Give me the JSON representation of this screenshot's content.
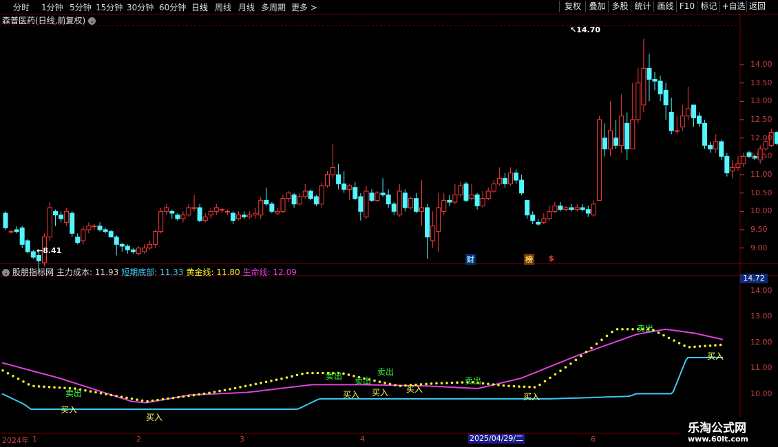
{
  "period_bar": {
    "items": [
      {
        "label": "分时",
        "x": 20
      },
      {
        "label": "1分钟",
        "x": 61
      },
      {
        "label": "5分钟",
        "x": 102
      },
      {
        "label": "15分钟",
        "x": 140
      },
      {
        "label": "30分钟",
        "x": 185
      },
      {
        "label": "60分钟",
        "x": 232
      },
      {
        "label": "日线",
        "x": 279,
        "active": true
      },
      {
        "label": "周线",
        "x": 313
      },
      {
        "label": "月线",
        "x": 347
      },
      {
        "label": "多周期",
        "x": 380
      },
      {
        "label": "更多",
        "x": 424
      }
    ],
    "more_arrow": ">",
    "right_buttons": [
      "复权",
      "叠加",
      "多股",
      "统计",
      "画线",
      "F10",
      "标记",
      "+自选",
      "返回"
    ]
  },
  "stock": {
    "title": "森普医药(日线,前复权)",
    "dropdown_icon": "⌄"
  },
  "price_axis": {
    "ticks": [
      "14.00",
      "13.50",
      "13.00",
      "12.50",
      "12.00",
      "11.50",
      "11.00",
      "10.50",
      "10.00",
      "9.50",
      "9.00"
    ]
  },
  "annotations": {
    "high": "14.70",
    "low": "8.41",
    "events": [
      "财",
      "榜",
      "$"
    ]
  },
  "indicator": {
    "name": "股朋指标网",
    "values": [
      {
        "label": "主力成本:",
        "value": "11.93",
        "color": "#dddddd"
      },
      {
        "label": "短期底部:",
        "value": "11.33",
        "color": "#3cc8f0"
      },
      {
        "label": "黄金线:",
        "value": "11.80",
        "color": "#f0f028"
      },
      {
        "label": "生命线:",
        "value": "12.09",
        "color": "#e040e0"
      }
    ],
    "axis_ticks": [
      "14.00",
      "13.00",
      "12.00",
      "11.00",
      "10.00"
    ],
    "current": "14.72",
    "signals": {
      "sell": "卖出",
      "buy": "买入"
    }
  },
  "date_axis": {
    "labels": [
      "2024年",
      "1",
      "2",
      "3",
      "4",
      "5",
      "6"
    ],
    "highlight": "2025/04/29/二"
  },
  "watermark": {
    "line1": "乐淘公式网",
    "line2": "www.60lt.com"
  },
  "colors": {
    "up": "#ff3c3c",
    "down": "#53f5ff",
    "border": "#7a0000",
    "axis_text": "#d04040",
    "life": "#e040e0",
    "short_bottom": "#3cc8f0",
    "gold": "#f0f028"
  },
  "chart_data": {
    "type": "candlestick",
    "title": "森普医药(日线,前复权)",
    "ylim": [
      8.6,
      15.05
    ],
    "candles": [
      [
        9.95,
        9.55,
        10.0,
        9.5
      ],
      [
        9.45,
        9.45,
        9.5,
        9.4
      ],
      [
        9.5,
        9.45,
        9.6,
        9.4
      ],
      [
        9.55,
        9.1,
        9.6,
        9.0
      ],
      [
        9.2,
        8.9,
        9.25,
        8.85
      ],
      [
        8.9,
        8.75,
        8.95,
        8.7
      ],
      [
        8.8,
        8.65,
        8.9,
        8.41
      ],
      [
        8.6,
        9.3,
        9.4,
        8.5
      ],
      [
        9.3,
        10.1,
        10.25,
        9.2
      ],
      [
        10.0,
        9.9,
        10.05,
        9.6
      ],
      [
        9.9,
        9.8,
        10.0,
        9.7
      ],
      [
        9.7,
        10.0,
        10.1,
        9.6
      ],
      [
        9.95,
        9.4,
        10.0,
        9.3
      ],
      [
        9.3,
        9.15,
        9.4,
        9.1
      ],
      [
        9.2,
        9.5,
        9.6,
        9.1
      ],
      [
        9.5,
        9.6,
        9.7,
        9.4
      ],
      [
        9.6,
        9.6,
        9.65,
        9.5
      ],
      [
        9.6,
        9.5,
        9.7,
        9.45
      ],
      [
        9.5,
        9.45,
        9.55,
        9.4
      ],
      [
        9.45,
        9.3,
        9.5,
        9.3
      ],
      [
        9.3,
        9.1,
        9.35,
        8.8
      ],
      [
        9.1,
        9.05,
        9.15,
        8.9
      ],
      [
        9.05,
        8.95,
        9.1,
        8.85
      ],
      [
        8.95,
        8.9,
        9.0,
        8.85
      ],
      [
        8.85,
        9.0,
        9.05,
        8.8
      ],
      [
        8.9,
        9.0,
        9.1,
        8.85
      ],
      [
        9.0,
        9.1,
        9.2,
        8.95
      ],
      [
        9.1,
        9.45,
        9.5,
        9.0
      ],
      [
        9.45,
        10.0,
        10.1,
        9.4
      ],
      [
        10.0,
        10.1,
        10.2,
        9.9
      ],
      [
        10.0,
        9.95,
        10.05,
        9.8
      ],
      [
        9.9,
        9.8,
        9.95,
        9.75
      ],
      [
        9.8,
        9.9,
        10.0,
        9.7
      ],
      [
        9.9,
        10.1,
        10.2,
        9.85
      ],
      [
        10.1,
        10.1,
        10.45,
        10.0
      ],
      [
        10.1,
        9.75,
        10.2,
        9.7
      ],
      [
        9.75,
        9.85,
        9.95,
        9.7
      ],
      [
        9.9,
        10.0,
        10.1,
        9.8
      ],
      [
        10.0,
        10.1,
        10.2,
        9.9
      ],
      [
        10.05,
        10.05,
        10.1,
        9.95
      ],
      [
        10.0,
        10.0,
        10.05,
        9.9
      ],
      [
        9.95,
        9.75,
        10.0,
        9.65
      ],
      [
        9.8,
        9.9,
        10.0,
        9.75
      ],
      [
        9.9,
        9.85,
        10.0,
        9.8
      ],
      [
        9.85,
        9.9,
        10.0,
        9.8
      ],
      [
        9.9,
        9.95,
        10.1,
        9.8
      ],
      [
        9.9,
        10.3,
        10.4,
        9.8
      ],
      [
        10.3,
        10.2,
        10.65,
        10.15
      ],
      [
        10.2,
        10.0,
        10.25,
        9.95
      ],
      [
        9.95,
        10.0,
        10.1,
        9.9
      ],
      [
        10.0,
        10.35,
        10.45,
        9.95
      ],
      [
        10.35,
        10.5,
        10.55,
        10.25
      ],
      [
        10.45,
        10.2,
        10.5,
        10.1
      ],
      [
        10.2,
        10.4,
        10.5,
        10.15
      ],
      [
        10.4,
        10.55,
        10.75,
        10.35
      ],
      [
        10.55,
        10.35,
        10.6,
        10.3
      ],
      [
        10.4,
        10.2,
        10.45,
        10.15
      ],
      [
        10.2,
        10.7,
        10.8,
        10.1
      ],
      [
        10.7,
        11.0,
        11.1,
        10.65
      ],
      [
        11.0,
        11.2,
        11.85,
        10.9
      ],
      [
        11.0,
        10.75,
        11.3,
        10.6
      ],
      [
        10.75,
        10.6,
        11.1,
        10.5
      ],
      [
        10.6,
        10.7,
        10.75,
        10.3
      ],
      [
        10.65,
        10.35,
        10.8,
        10.3
      ],
      [
        10.4,
        10.0,
        10.5,
        9.75
      ],
      [
        9.85,
        10.55,
        10.7,
        9.8
      ],
      [
        10.5,
        10.3,
        10.6,
        10.25
      ],
      [
        10.3,
        10.5,
        10.55,
        10.25
      ],
      [
        10.5,
        10.45,
        10.9,
        10.4
      ],
      [
        10.45,
        10.2,
        10.6,
        10.1
      ],
      [
        10.2,
        10.0,
        10.25,
        9.9
      ],
      [
        9.9,
        10.55,
        10.75,
        9.85
      ],
      [
        10.5,
        10.1,
        10.6,
        10.0
      ],
      [
        10.1,
        10.35,
        10.4,
        10.05
      ],
      [
        10.35,
        10.0,
        10.5,
        9.95
      ],
      [
        10.0,
        10.1,
        10.85,
        9.6
      ],
      [
        10.1,
        9.3,
        10.2,
        8.7
      ],
      [
        9.2,
        9.6,
        10.0,
        9.0
      ],
      [
        9.45,
        10.1,
        10.5,
        8.9
      ],
      [
        10.0,
        10.3,
        10.5,
        9.9
      ],
      [
        10.3,
        10.25,
        10.45,
        10.15
      ],
      [
        10.25,
        10.45,
        10.75,
        10.2
      ],
      [
        10.45,
        10.7,
        10.8,
        10.4
      ],
      [
        10.75,
        10.3,
        10.8,
        10.25
      ],
      [
        10.35,
        10.45,
        10.75,
        10.3
      ],
      [
        10.45,
        10.15,
        10.5,
        10.05
      ],
      [
        10.15,
        10.35,
        10.55,
        10.1
      ],
      [
        10.35,
        10.55,
        10.65,
        10.3
      ],
      [
        10.55,
        10.75,
        10.85,
        10.5
      ],
      [
        10.75,
        10.9,
        11.2,
        10.7
      ],
      [
        10.9,
        10.75,
        11.05,
        10.65
      ],
      [
        10.75,
        11.05,
        11.2,
        10.7
      ],
      [
        11.05,
        10.85,
        11.15,
        10.75
      ],
      [
        10.85,
        10.5,
        11.0,
        10.45
      ],
      [
        10.3,
        9.9,
        10.3,
        9.8
      ],
      [
        9.9,
        9.75,
        10.0,
        9.65
      ],
      [
        9.7,
        9.65,
        9.8,
        9.6
      ],
      [
        9.7,
        9.8,
        9.95,
        9.65
      ],
      [
        9.8,
        10.0,
        10.15,
        9.75
      ],
      [
        10.0,
        10.15,
        10.25,
        9.95
      ],
      [
        10.15,
        10.05,
        10.25,
        10.0
      ],
      [
        10.05,
        10.1,
        10.15,
        10.0
      ],
      [
        10.1,
        10.05,
        10.2,
        10.0
      ],
      [
        10.05,
        10.1,
        10.2,
        10.0
      ],
      [
        10.1,
        10.05,
        10.2,
        10.0
      ],
      [
        10.05,
        9.95,
        10.15,
        9.85
      ],
      [
        9.9,
        10.2,
        10.3,
        9.85
      ],
      [
        10.3,
        12.5,
        12.6,
        10.3
      ],
      [
        12.0,
        11.7,
        12.4,
        11.5
      ],
      [
        11.7,
        12.2,
        13.0,
        11.5
      ],
      [
        12.0,
        11.8,
        12.5,
        11.7
      ],
      [
        11.8,
        12.6,
        13.2,
        11.6
      ],
      [
        12.4,
        11.7,
        12.7,
        11.4
      ],
      [
        11.7,
        12.5,
        13.5,
        11.7
      ],
      [
        12.5,
        13.5,
        13.9,
        12.4
      ],
      [
        12.9,
        13.9,
        14.7,
        12.7
      ],
      [
        13.9,
        13.6,
        14.3,
        13.0
      ],
      [
        13.6,
        13.55,
        13.8,
        13.3
      ],
      [
        13.55,
        13.2,
        13.7,
        13.0
      ],
      [
        13.3,
        12.9,
        13.5,
        12.5
      ],
      [
        12.7,
        12.2,
        13.1,
        12.1
      ],
      [
        12.2,
        12.2,
        12.6,
        12.1
      ],
      [
        12.3,
        12.6,
        12.9,
        12.2
      ],
      [
        12.6,
        12.8,
        13.4,
        12.5
      ],
      [
        12.9,
        12.55,
        12.9,
        12.3
      ],
      [
        12.6,
        12.4,
        12.7,
        12.3
      ],
      [
        12.4,
        11.8,
        12.5,
        11.7
      ],
      [
        11.8,
        11.7,
        11.9,
        11.6
      ],
      [
        11.7,
        11.9,
        12.1,
        11.6
      ],
      [
        11.9,
        11.5,
        11.95,
        11.4
      ],
      [
        11.5,
        11.05,
        11.6,
        10.95
      ],
      [
        11.1,
        11.2,
        11.4,
        10.9
      ],
      [
        11.2,
        11.3,
        11.5,
        11.1
      ],
      [
        11.3,
        11.5,
        11.6,
        11.2
      ],
      [
        11.6,
        11.5,
        11.65,
        11.45
      ],
      [
        11.5,
        11.45,
        11.55,
        11.4
      ],
      [
        11.4,
        11.7,
        11.8,
        11.3
      ],
      [
        11.7,
        11.9,
        12.0,
        11.65
      ],
      [
        11.8,
        12.15,
        12.25,
        11.75
      ],
      [
        12.15,
        11.85,
        12.2,
        11.8
      ],
      [
        11.85,
        12.0,
        12.05,
        11.7
      ]
    ],
    "indicator_series": {
      "ylim": [
        9.0,
        15.0
      ],
      "life_line": [
        [
          0,
          11.2
        ],
        [
          0.08,
          10.6
        ],
        [
          0.18,
          9.7
        ],
        [
          0.2,
          9.65
        ],
        [
          0.26,
          9.95
        ],
        [
          0.34,
          10.05
        ],
        [
          0.43,
          10.35
        ],
        [
          0.5,
          10.35
        ],
        [
          0.59,
          10.3
        ],
        [
          0.66,
          10.2
        ],
        [
          0.72,
          10.6
        ],
        [
          0.8,
          11.5
        ],
        [
          0.88,
          12.3
        ],
        [
          0.92,
          12.5
        ],
        [
          0.96,
          12.35
        ],
        [
          1.0,
          12.1
        ]
      ],
      "short_bottom": [
        [
          0,
          10.0
        ],
        [
          0.03,
          9.6
        ],
        [
          0.04,
          9.4
        ],
        [
          0.41,
          9.4
        ],
        [
          0.44,
          9.8
        ],
        [
          0.46,
          9.8
        ],
        [
          0.76,
          9.8
        ],
        [
          0.87,
          9.9
        ],
        [
          0.88,
          10.0
        ],
        [
          0.93,
          10.0
        ],
        [
          0.95,
          11.4
        ],
        [
          1.0,
          11.4
        ]
      ],
      "gold_line": [
        [
          0,
          10.9
        ],
        [
          0.04,
          10.3
        ],
        [
          0.1,
          10.2
        ],
        [
          0.14,
          10.0
        ],
        [
          0.2,
          9.7
        ],
        [
          0.28,
          10.0
        ],
        [
          0.32,
          10.2
        ],
        [
          0.39,
          10.6
        ],
        [
          0.42,
          10.8
        ],
        [
          0.47,
          10.8
        ],
        [
          0.5,
          10.6
        ],
        [
          0.55,
          10.3
        ],
        [
          0.6,
          10.4
        ],
        [
          0.65,
          10.45
        ],
        [
          0.7,
          10.3
        ],
        [
          0.74,
          10.25
        ],
        [
          0.79,
          11.2
        ],
        [
          0.85,
          12.5
        ],
        [
          0.9,
          12.5
        ],
        [
          0.95,
          11.8
        ],
        [
          1.0,
          11.9
        ]
      ]
    }
  }
}
